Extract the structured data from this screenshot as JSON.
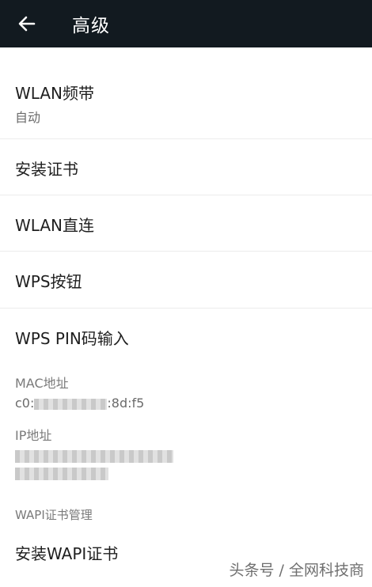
{
  "header": {
    "title": "高级"
  },
  "items": [
    {
      "label": "WLAN频带",
      "sub": "自动"
    },
    {
      "label": "安装证书"
    },
    {
      "label": "WLAN直连"
    },
    {
      "label": "WPS按钮"
    },
    {
      "label": "WPS PIN码输入"
    }
  ],
  "mac": {
    "label": "MAC地址",
    "value": "c0:",
    "value_tail": ":8d:f5"
  },
  "ip": {
    "label": "IP地址"
  },
  "wapi_section": {
    "label": "WAPI证书管理"
  },
  "wapi_install": {
    "label": "安装WAPI证书"
  },
  "watermark": "头条号 / 全网科技商"
}
